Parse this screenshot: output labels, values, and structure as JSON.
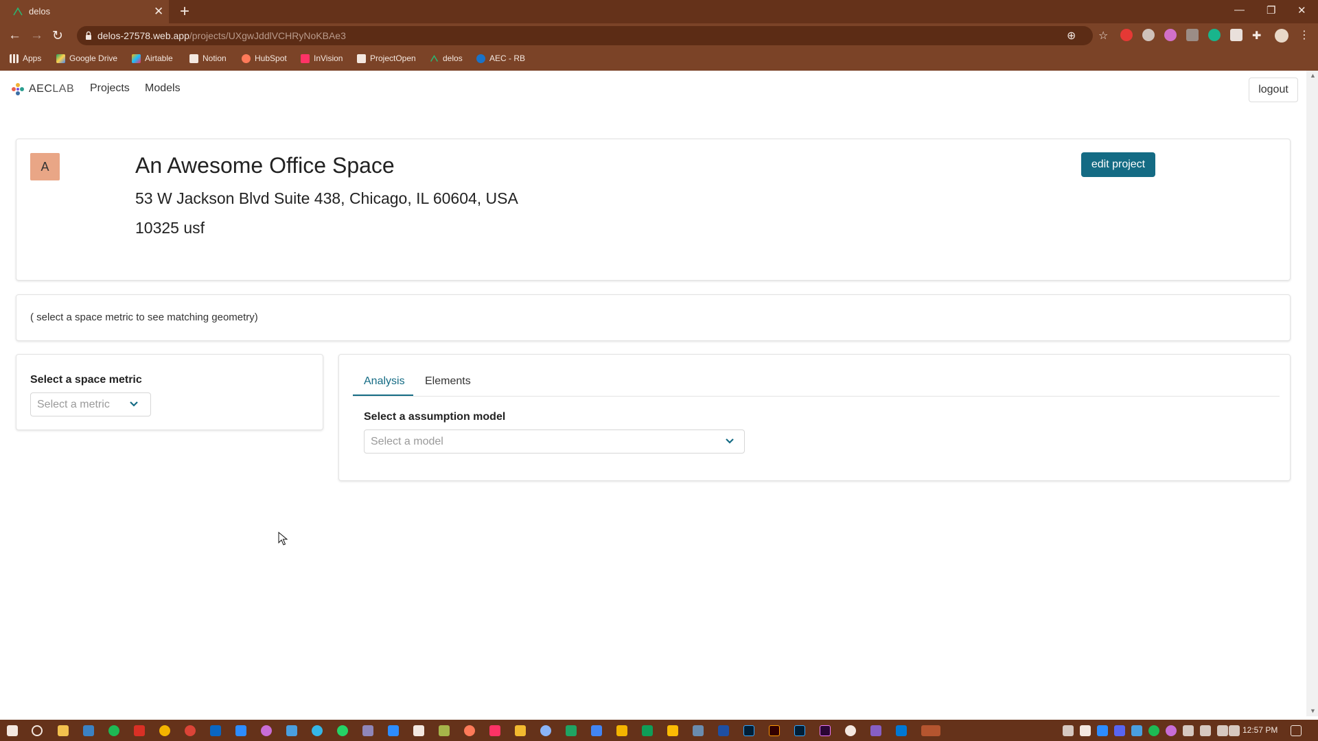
{
  "browser": {
    "tab_title": "delos",
    "url_host": "delos-27578.web.app",
    "url_path": "/projects/UXgwJddlVCHRyNoKBAe3",
    "bookmarks": [
      "Apps",
      "Google Drive",
      "Airtable",
      "Notion",
      "HubSpot",
      "InVision",
      "ProjectOpen",
      "delos",
      "AEC - RB"
    ]
  },
  "nav": {
    "logo_text_a": "AEC",
    "logo_text_b": "LAB",
    "links": [
      "Projects",
      "Models"
    ],
    "logout_label": "logout"
  },
  "project": {
    "avatar_letter": "A",
    "title": "An Awesome Office Space",
    "address": "53 W Jackson Blvd Suite 438, Chicago, IL 60604, USA",
    "area": "10325 usf",
    "edit_label": "edit project"
  },
  "geometry_hint": "( select a space metric to see matching geometry)",
  "metric_panel": {
    "label": "Select a space metric",
    "placeholder": "Select a metric"
  },
  "analysis_panel": {
    "tabs": [
      "Analysis",
      "Elements"
    ],
    "active_tab": "Analysis",
    "label": "Select a assumption model",
    "placeholder": "Select a model"
  },
  "taskbar": {
    "clock": "12:57 PM"
  },
  "colors": {
    "chrome": "#7b4327",
    "accent": "#146b84",
    "avatar": "#e9a686"
  }
}
